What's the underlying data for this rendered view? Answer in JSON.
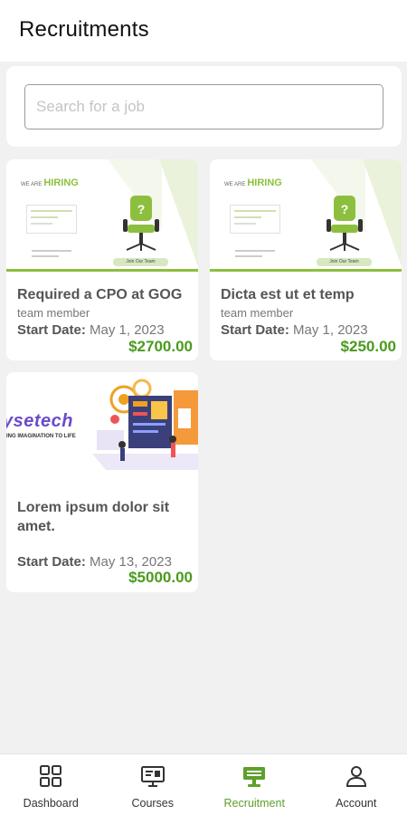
{
  "header": {
    "title": "Recruitments"
  },
  "search": {
    "placeholder": "Search for a job",
    "value": ""
  },
  "jobs": [
    {
      "image": {
        "type": "hiring-poster",
        "line1": "WE ARE",
        "line2": "HIRING",
        "button": "Join Our Team"
      },
      "title": "Required a CPO at GOG",
      "subtitle": "team member",
      "start_label": "Start Date:",
      "start_date": "May 1, 2023",
      "price": "$2700.00"
    },
    {
      "image": {
        "type": "hiring-poster",
        "line1": "WE ARE",
        "line2": "HIRING",
        "button": "Join Our Team"
      },
      "title": "Dicta est ut et temp",
      "subtitle": "team member",
      "start_label": "Start Date:",
      "start_date": "May 1, 2023",
      "price": "$250.00"
    },
    {
      "image": {
        "type": "tech-banner",
        "logo": "ysetech",
        "tagline": "ING IMAGINATION TO LIFE"
      },
      "title": "Lorem ipsum dolor sit amet.",
      "start_label": "Start Date:",
      "start_date": "May 13, 2023",
      "price": "$5000.00"
    }
  ],
  "bottom_nav": {
    "items": [
      {
        "label": "Dashboard",
        "icon": "grid-icon",
        "active": false
      },
      {
        "label": "Courses",
        "icon": "courses-icon",
        "active": false
      },
      {
        "label": "Recruitment",
        "icon": "recruitment-icon",
        "active": true
      },
      {
        "label": "Account",
        "icon": "person-icon",
        "active": false
      }
    ]
  },
  "colors": {
    "accent": "#5ea02a",
    "price": "#4a9a1e",
    "background": "#f1f1f1"
  }
}
